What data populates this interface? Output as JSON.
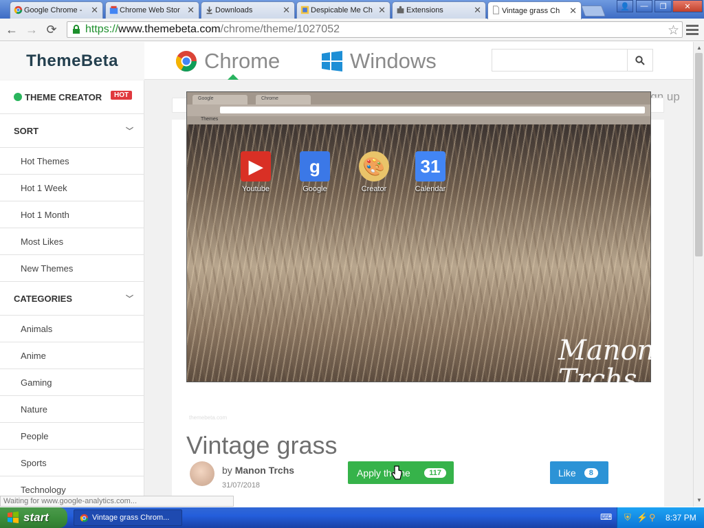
{
  "browser": {
    "tabs": [
      {
        "title": "Google Chrome -",
        "active": false
      },
      {
        "title": "Chrome Web Stor",
        "active": false
      },
      {
        "title": "Downloads",
        "active": false
      },
      {
        "title": "Despicable Me Ch",
        "active": false
      },
      {
        "title": "Extensions",
        "active": false
      },
      {
        "title": "Vintage grass Ch",
        "active": true
      }
    ],
    "url": {
      "scheme": "https://",
      "host": "www.themebeta.com",
      "path": "/chrome/theme/1027052"
    }
  },
  "site": {
    "brand": "ThemeBeta",
    "nav": [
      {
        "label": "Chrome"
      },
      {
        "label": "Windows"
      }
    ],
    "sign_in": "Sign in / Sign up"
  },
  "sidebar": {
    "theme_creator": "THEME CREATOR",
    "hot_badge": "HOT",
    "sort_heading": "SORT",
    "sort_items": [
      "Hot Themes",
      "Hot 1 Week",
      "Hot 1 Month",
      "Most Likes",
      "New Themes"
    ],
    "categories_heading": "CATEGORIES",
    "category_items": [
      "Animals",
      "Anime",
      "Gaming",
      "Nature",
      "People",
      "Sports",
      "Technology"
    ]
  },
  "preview": {
    "tabs": [
      "Google",
      "Chrome"
    ],
    "bookmark": "Themes",
    "apps": [
      {
        "label": "Youtube"
      },
      {
        "label": "Google"
      },
      {
        "label": "Creator"
      },
      {
        "label": "Calendar"
      }
    ],
    "signature": "Manon Trchs",
    "watermark": "themebeta.com"
  },
  "theme": {
    "title": "Vintage grass",
    "author_prefix": "by",
    "author": "Manon Trchs",
    "date": "31/07/2018",
    "apply_label": "Apply theme",
    "apply_count": "117",
    "like_label": "Like",
    "like_count": "8"
  },
  "status_bar": "Waiting for www.google-analytics.com...",
  "taskbar": {
    "start": "start",
    "task_title": "Vintage grass Chrom...",
    "clock": "8:37 PM"
  },
  "colors": {
    "brand_green": "#36b34a",
    "like_blue": "#2c93d6",
    "hot_red": "#e0393e"
  }
}
